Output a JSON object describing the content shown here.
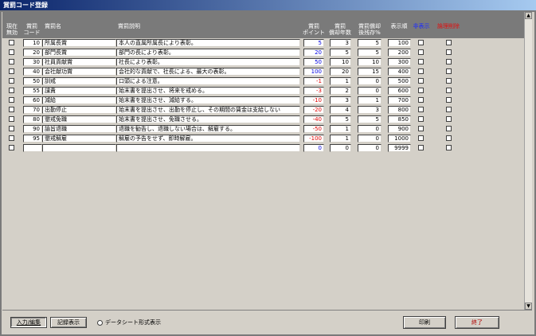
{
  "window": {
    "title": "賞罰コード登録"
  },
  "headers": {
    "active": "現在\n無効",
    "code": "賞罰\nコード",
    "name": "賞罰名",
    "desc": "賞罰説明",
    "point": "賞罰\nポイント",
    "years": "賞罰\n償却年数",
    "restore": "賞罰償却\n後残存%",
    "order": "表示順",
    "hide": "非表示",
    "delete": "論理削除"
  },
  "rows": [
    {
      "code": "10",
      "name": "所属長賞",
      "desc": "本人の直属所属長により表彰。",
      "point": "5",
      "years": "3",
      "restore": "5",
      "order": "100"
    },
    {
      "code": "20",
      "name": "部門長賞",
      "desc": "部門の長により表彰。",
      "point": "20",
      "years": "5",
      "restore": "5",
      "order": "200"
    },
    {
      "code": "30",
      "name": "社員貢献賞",
      "desc": "社長により表彰。",
      "point": "50",
      "years": "10",
      "restore": "10",
      "order": "300"
    },
    {
      "code": "40",
      "name": "会社献功賞",
      "desc": "会社的な貢献で、社長による、最大の表彰。",
      "point": "100",
      "years": "20",
      "restore": "15",
      "order": "400"
    },
    {
      "code": "50",
      "name": "訓戒",
      "desc": "口頭による注意。",
      "point": "-1",
      "years": "1",
      "restore": "0",
      "order": "500"
    },
    {
      "code": "55",
      "name": "譴責",
      "desc": "始末書を提出させ、将来を戒める。",
      "point": "-3",
      "years": "2",
      "restore": "0",
      "order": "600"
    },
    {
      "code": "60",
      "name": "減給",
      "desc": "始末書を提出させ、減給する。",
      "point": "-10",
      "years": "3",
      "restore": "1",
      "order": "700"
    },
    {
      "code": "70",
      "name": "出勤停止",
      "desc": "始末書を提出させ、出勤を停止し、その期間の賃金は支給しない",
      "point": "-20",
      "years": "4",
      "restore": "3",
      "order": "800"
    },
    {
      "code": "80",
      "name": "懲戒免職",
      "desc": "始末書を提出させ、免職させる。",
      "point": "-40",
      "years": "5",
      "restore": "5",
      "order": "850"
    },
    {
      "code": "90",
      "name": "諭旨退職",
      "desc": "退職を勧告し、退職しない場合は、解雇する。",
      "point": "-50",
      "years": "1",
      "restore": "0",
      "order": "900"
    },
    {
      "code": "95",
      "name": "懲戒解雇",
      "desc": "解雇の予告をせず、即時解雇。",
      "point": "-100",
      "years": "1",
      "restore": "0",
      "order": "1000"
    },
    {
      "code": "",
      "name": "",
      "desc": "",
      "point": "0",
      "years": "0",
      "restore": "0",
      "order": "9999"
    }
  ],
  "footer": {
    "tab_edit": "入力/編集",
    "tab_list": "記録表示",
    "datasheet": "データシート形式表示",
    "print": "印刷",
    "exit": "終了"
  },
  "colors": {
    "point_positive": "#0000e0",
    "point_negative": "#e00000",
    "header_bg": "#7a7a7a",
    "hide_label": "#1b2bff",
    "delete_label": "#e01010"
  }
}
